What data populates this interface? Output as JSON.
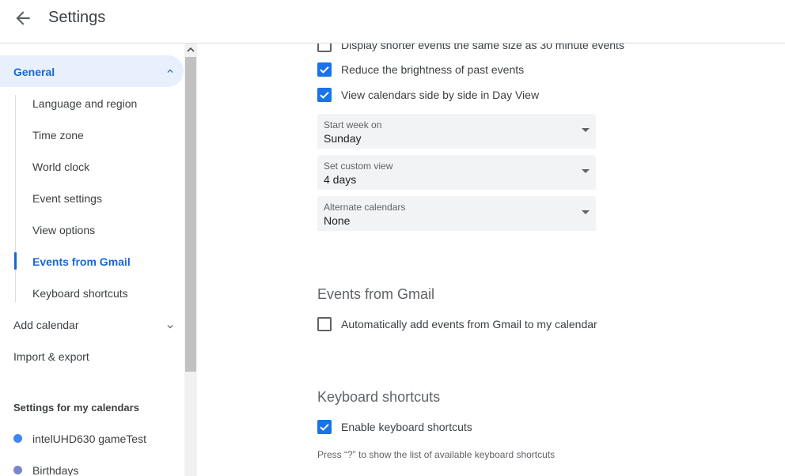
{
  "header": {
    "title": "Settings"
  },
  "sidebar": {
    "general": {
      "label": "General"
    },
    "general_items": [
      {
        "label": "Language and region"
      },
      {
        "label": "Time zone"
      },
      {
        "label": "World clock"
      },
      {
        "label": "Event settings"
      },
      {
        "label": "View options"
      },
      {
        "label": "Events from Gmail"
      },
      {
        "label": "Keyboard shortcuts"
      }
    ],
    "add_calendar": {
      "label": "Add calendar"
    },
    "import_export": {
      "label": "Import & export"
    },
    "my_calendars_header": "Settings for my calendars",
    "calendars": [
      {
        "label": "intelUHD630 gameTest",
        "color": "#4285f4"
      },
      {
        "label": "Birthdays",
        "color": "#7986cb"
      }
    ]
  },
  "main": {
    "view_options": {
      "shorter_events": {
        "label": "Display shorter events the same size as 30 minute events",
        "checked": false
      },
      "reduce_brightness": {
        "label": "Reduce the brightness of past events",
        "checked": true
      },
      "side_by_side": {
        "label": "View calendars side by side in Day View",
        "checked": true
      },
      "start_week": {
        "caption": "Start week on",
        "value": "Sunday"
      },
      "custom_view": {
        "caption": "Set custom view",
        "value": "4 days"
      },
      "alternate_calendars": {
        "caption": "Alternate calendars",
        "value": "None"
      }
    },
    "events_from_gmail": {
      "title": "Events from Gmail",
      "auto_add": {
        "label": "Automatically add events from Gmail to my calendar",
        "checked": false
      }
    },
    "keyboard_shortcuts": {
      "title": "Keyboard shortcuts",
      "enable": {
        "label": "Enable keyboard shortcuts",
        "checked": true
      },
      "help": "Press “?” to show the list of available keyboard shortcuts"
    }
  },
  "colors": {
    "accent": "#1a73e8",
    "active_nav_text": "#1967d2",
    "active_nav_bg": "#e8f0fe",
    "field_bg": "#f1f3f4"
  }
}
